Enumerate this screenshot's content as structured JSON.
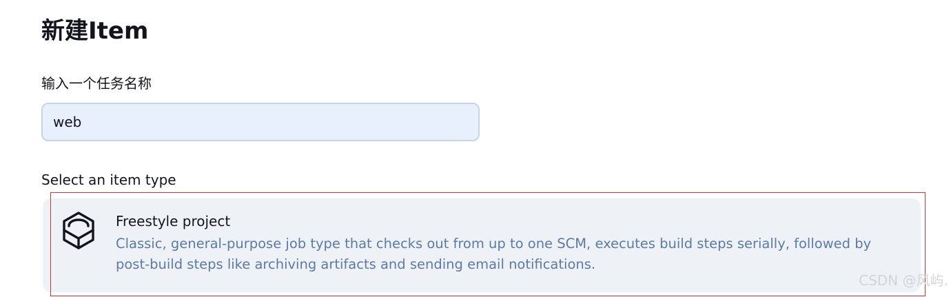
{
  "header": {
    "title": "新建Item"
  },
  "name_field": {
    "label": "输入一个任务名称",
    "value": "web"
  },
  "item_types": {
    "label": "Select an item type",
    "items": [
      {
        "name": "Freestyle project",
        "description": "Classic, general-purpose job type that checks out from up to one SCM, executes build steps serially, followed by post-build steps like archiving artifacts and sending email notifications.",
        "icon": "cube-icon"
      }
    ]
  },
  "watermark": {
    "text": "CSDN @风屿."
  },
  "colors": {
    "input_background": "#e8f0fe",
    "card_background": "#eef1f6",
    "description_text": "#5c7aa6",
    "highlight_border": "#d23232"
  }
}
